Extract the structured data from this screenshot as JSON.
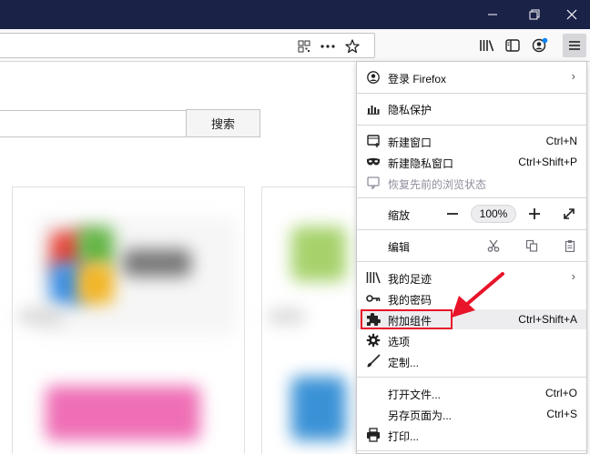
{
  "menu": {
    "signin": {
      "label": "登录 Firefox",
      "icon": "account-icon"
    },
    "privacy": {
      "label": "隐私保护",
      "icon": "dashboard-icon"
    },
    "new_window": {
      "label": "新建窗口",
      "shortcut": "Ctrl+N",
      "icon": "new-window-icon"
    },
    "new_private": {
      "label": "新建隐私窗口",
      "shortcut": "Ctrl+Shift+P",
      "icon": "private-mask-icon"
    },
    "restore": {
      "label": "恢复先前的浏览状态",
      "icon": "restore-session-icon"
    },
    "zoom": {
      "label": "缩放",
      "value": "100%"
    },
    "edit": {
      "label": "编辑"
    },
    "library": {
      "label": "我的足迹",
      "icon": "library-icon"
    },
    "logins": {
      "label": "我的密码",
      "icon": "key-icon"
    },
    "addons": {
      "label": "附加组件",
      "shortcut": "Ctrl+Shift+A",
      "icon": "puzzle-icon"
    },
    "options": {
      "label": "选项",
      "icon": "gear-icon"
    },
    "customize": {
      "label": "定制...",
      "icon": "brush-icon"
    },
    "open_file": {
      "label": "打开文件...",
      "shortcut": "Ctrl+O"
    },
    "save_page": {
      "label": "另存页面为...",
      "shortcut": "Ctrl+S"
    },
    "print": {
      "label": "打印...",
      "icon": "printer-icon"
    }
  },
  "page": {
    "search_button": "搜索"
  },
  "colors": {
    "titlebar": "#1b2248",
    "highlight_box": "#e8142a",
    "arrow": "#e8142a"
  }
}
